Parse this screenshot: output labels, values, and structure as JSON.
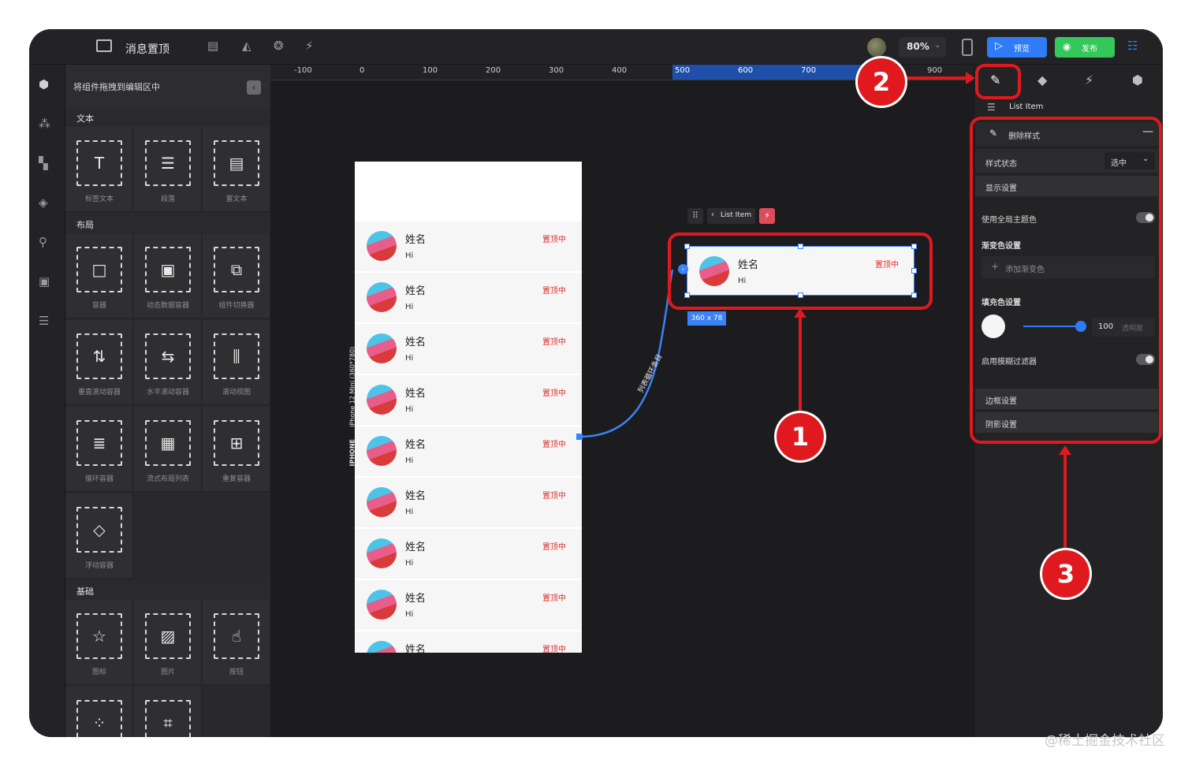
{
  "topbar": {
    "title": "消息置顶",
    "zoom": "80%",
    "preview_label": "预览",
    "publish_label": "发布"
  },
  "left_panel": {
    "drag_hint": "将组件拖拽到编辑区中",
    "sections": {
      "text": "文本",
      "layout": "布局",
      "basic": "基础"
    },
    "text_items": [
      "标签文本",
      "段落",
      "富文本"
    ],
    "layout_items": [
      "容器",
      "动态数据容器",
      "组件切换器",
      "垂直滚动容器",
      "水平滚动容器",
      "滚动视图",
      "循环容器",
      "流式布局列表",
      "重复容器",
      "浮动容器"
    ],
    "basic_items": [
      "图标",
      "图片",
      "按钮"
    ]
  },
  "ruler": {
    "labels": [
      "-100",
      "0",
      "100",
      "200",
      "300",
      "400",
      "500",
      "600",
      "700",
      "900"
    ]
  },
  "device": {
    "label": "iPhone 12 Mini (360*780)",
    "platform": "IPHONE"
  },
  "list": {
    "name": "姓名",
    "sub": "Hi",
    "tag": "置顶中",
    "rows": 9
  },
  "selection": {
    "breadcrumb": "List Item",
    "size": "360 x 78",
    "link_label": "列表循环条目",
    "name": "姓名",
    "sub": "Hi",
    "tag": "置顶中"
  },
  "right_panel": {
    "component": "List Item",
    "delete_style": "删除样式",
    "style_state_label": "样式状态",
    "style_state_value": "选中",
    "display_settings": "显示设置",
    "use_global_theme": "使用全局主题色",
    "gradient_settings": "渐变色设置",
    "add_gradient": "添加渐变色",
    "fill_settings": "填充色设置",
    "opacity_value": "100",
    "opacity_placeholder": "透明度",
    "blur_filter": "启用模糊过滤器",
    "border_settings": "边框设置",
    "shadow_settings": "阴影设置"
  },
  "annotations": {
    "badge1": "1",
    "badge2": "2",
    "badge3": "3"
  },
  "watermark": "@稀土掘金技术社区",
  "colors": {
    "accent_red": "#e0191e",
    "preview_blue": "#2f7cf6",
    "publish_green": "#34c759",
    "tag_red": "#e02f2f"
  }
}
